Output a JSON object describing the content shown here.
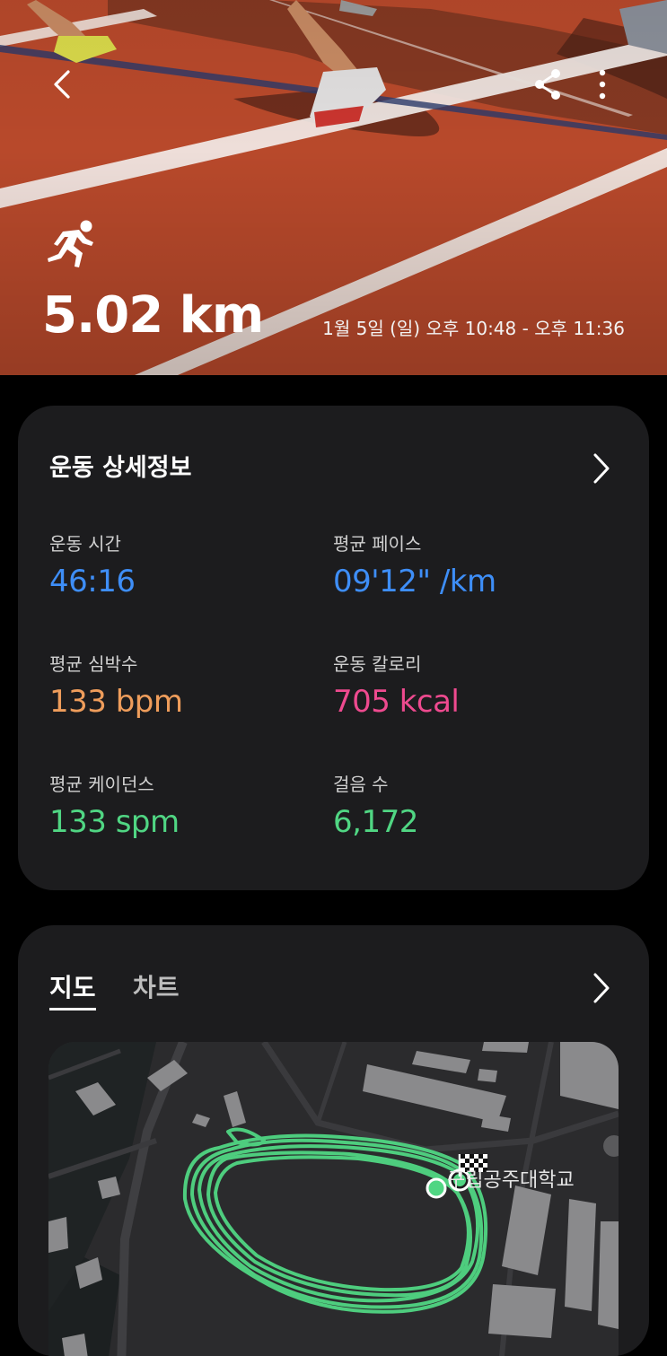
{
  "hero": {
    "distance": "5.02 km",
    "time_range": "1월 5일 (일) 오후 10:48 - 오후 11:36",
    "icons": {
      "back": "chevron-left-icon",
      "share": "share-icon",
      "more": "more-vertical-icon",
      "activity": "running-icon"
    }
  },
  "details": {
    "title": "운동 상세정보",
    "stats": [
      {
        "label": "운동 시간",
        "value": "46:16",
        "color": "#3e8ef7"
      },
      {
        "label": "평균 페이스",
        "value": "09'12\" /km",
        "color": "#3e8ef7"
      },
      {
        "label": "평균 심박수",
        "value": "133 bpm",
        "color": "#ef9d5b"
      },
      {
        "label": "운동 칼로리",
        "value": "705 kcal",
        "color": "#ee4a8f"
      },
      {
        "label": "평균 케이던스",
        "value": "133 spm",
        "color": "#50d683"
      },
      {
        "label": "걸음 수",
        "value": "6,172",
        "color": "#50d683"
      }
    ]
  },
  "map_section": {
    "tabs": [
      {
        "label": "지도",
        "selected": true
      },
      {
        "label": "차트",
        "selected": false
      }
    ],
    "place_label": "구립공주대학교",
    "route_color": "#50d683"
  }
}
